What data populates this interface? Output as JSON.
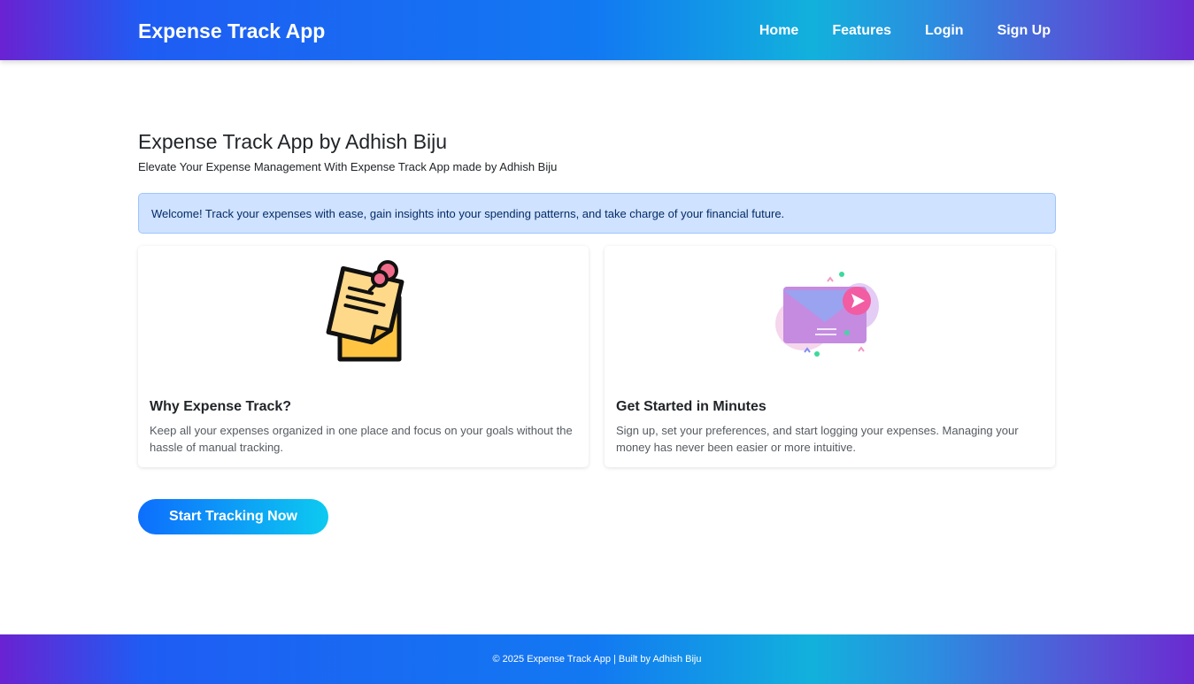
{
  "navbar": {
    "brand": "Expense Track App",
    "links": [
      "Home",
      "Features",
      "Login",
      "Sign Up"
    ]
  },
  "hero": {
    "title": "Expense Track App by Adhish Biju",
    "subtitle": "Elevate Your Expense Management With Expense Track App made by Adhish Biju"
  },
  "alert": {
    "text": "Welcome! Track your expenses with ease, gain insights into your spending patterns, and take charge of your financial future."
  },
  "cards": [
    {
      "icon": "sticky-note-icon",
      "title": "Why Expense Track?",
      "text": "Keep all your expenses organized in one place and focus on your goals without the hassle of manual tracking."
    },
    {
      "icon": "envelope-send-icon",
      "title": "Get Started in Minutes",
      "text": "Sign up, set your preferences, and start logging your expenses. Managing your money has never been easier or more intuitive."
    }
  ],
  "cta": {
    "label": "Start Tracking Now"
  },
  "footer": {
    "text": "© 2025 Expense Track App | Built by Adhish Biju"
  },
  "colors": {
    "primary": "#0d6efd",
    "accent": "#0dcaf0",
    "purple": "#6a22d2",
    "alert_bg": "#cfe2ff"
  }
}
